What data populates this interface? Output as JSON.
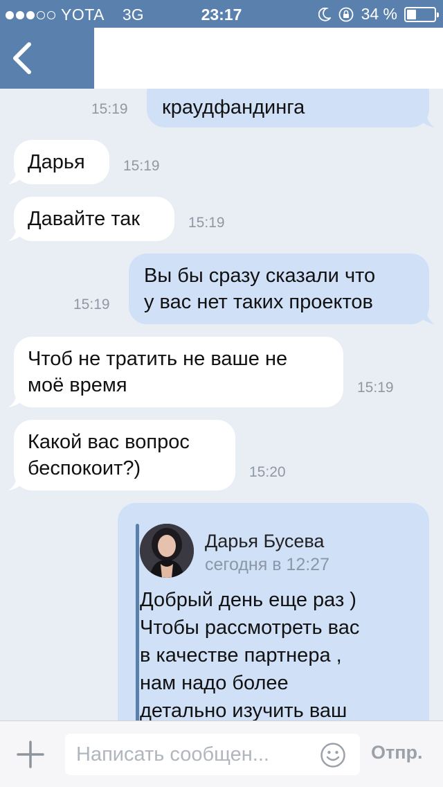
{
  "status_bar": {
    "carrier": "YOTA",
    "network": "3G",
    "time": "23:17",
    "battery_text": "34 %",
    "battery_level": 0.34
  },
  "chat": {
    "messages": [
      {
        "dir": "out",
        "text": "краудфандинга",
        "time": "15:19"
      },
      {
        "dir": "in",
        "text": "Дарья",
        "time": "15:19"
      },
      {
        "dir": "in",
        "text": "Давайте так",
        "time": "15:19"
      },
      {
        "dir": "out",
        "text": "Вы бы сразу сказали что\nу вас нет таких проектов",
        "time": "15:19"
      },
      {
        "dir": "in",
        "text": "Чтоб не тратить не ваше не\nмоё время",
        "time": "15:19"
      },
      {
        "dir": "in",
        "text": "Какой вас вопрос\nбеспокоит?)",
        "time": "15:20"
      }
    ],
    "forwarded": {
      "name": "Дарья Бусева",
      "date": "сегодня в 12:27",
      "text": "Добрый день еще раз )\nЧтобы рассмотреть вас\nв качестве партнера ,\nнам надо более\nдетально изучить ваш"
    }
  },
  "input_bar": {
    "placeholder": "Написать сообщен...",
    "send_label": "Отпр."
  },
  "colors": {
    "accent": "#5a81ad",
    "outgoing_bubble": "#cfe0f7",
    "incoming_bubble": "#ffffff",
    "background": "#e9eef4"
  }
}
